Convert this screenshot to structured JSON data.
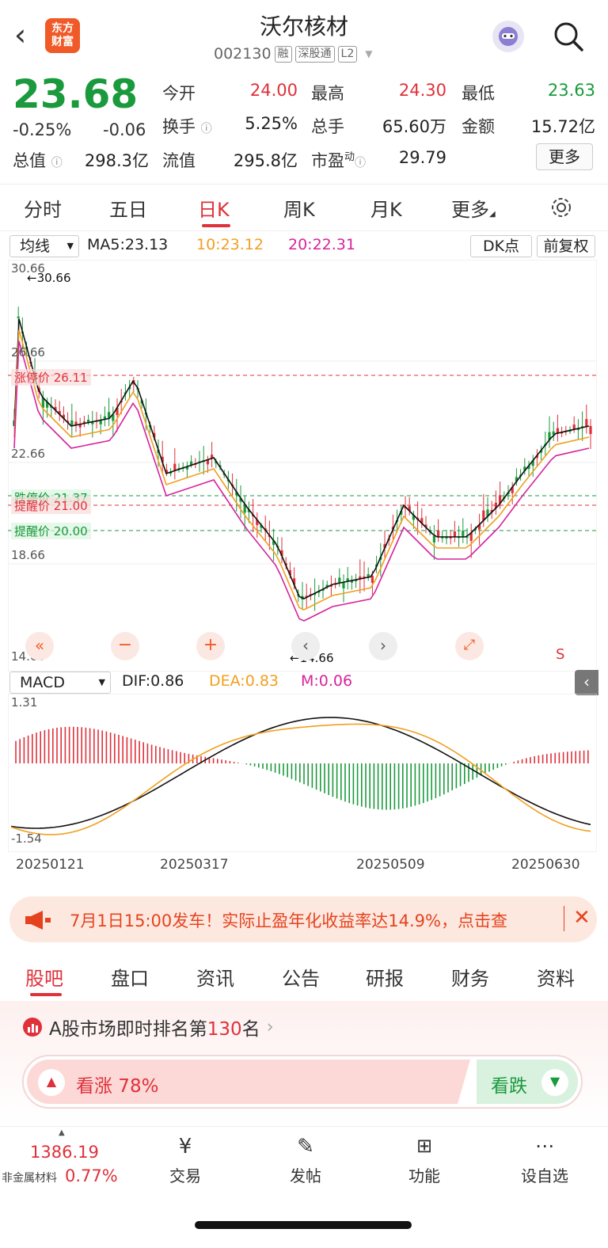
{
  "header": {
    "title": "沃尔核材",
    "code": "002130",
    "tags": [
      "融",
      "深股通",
      "L2"
    ],
    "logo_text": "东方财富"
  },
  "quote": {
    "price": "23.68",
    "change_pct": "-0.25%",
    "change": "-0.06",
    "open_label": "今开",
    "open": "24.00",
    "high_label": "最高",
    "high": "24.30",
    "low_label": "最低",
    "low": "23.63",
    "turnover_label": "换手",
    "turnover": "5.25%",
    "volume_label": "总手",
    "volume": "65.60万",
    "amount_label": "金额",
    "amount": "15.72亿",
    "mcap_label": "总值",
    "mcap": "298.3亿",
    "float_label": "流值",
    "float": "295.8亿",
    "pe_label": "市盈",
    "pe_sup": "动",
    "pe": "29.79",
    "more": "更多"
  },
  "ktabs": [
    "分时",
    "五日",
    "日K",
    "周K",
    "月K",
    "更多"
  ],
  "ma": {
    "select": "均线",
    "ma5": "MA5:23.13",
    "ma10": "10:23.12",
    "ma20": "20:22.31",
    "dk": "DK点",
    "fq": "前复权"
  },
  "kchart": {
    "y_labels": [
      "30.66",
      "26.66",
      "22.66",
      "18.66",
      "14.66"
    ],
    "high_mark": "30.66",
    "low_mark": "14.66",
    "limit_up": "涨停价 26.11",
    "limit_down": "跌停价 21.37",
    "remind1": "提醒价 21.00",
    "remind2": "提醒价 20.00",
    "s_marker": "S"
  },
  "macd": {
    "select": "MACD",
    "dif": "DIF:0.86",
    "dea": "DEA:0.83",
    "m": "M:0.06",
    "top": "1.31",
    "bottom": "-1.54"
  },
  "dates": [
    "20250121",
    "20250317",
    "20250509",
    "20250630"
  ],
  "promo": {
    "text": "7月1日15:00发车！实际止盈年化收益率达14.9%，点击查"
  },
  "btabs": [
    "股吧",
    "盘口",
    "资讯",
    "公告",
    "研报",
    "财务",
    "资料"
  ],
  "rank": {
    "prefix": "A股市场即时排名第",
    "num": "130",
    "suffix": "名"
  },
  "vote": {
    "up": "看涨 78%",
    "down": "看跌",
    "up_pct": 78
  },
  "nav": {
    "index_value": "1386.19",
    "index_name": "非金属材料",
    "index_pct": "0.77%",
    "items": [
      "交易",
      "发帖",
      "功能",
      "设自选"
    ]
  },
  "colors": {
    "red": "#e0303a",
    "green": "#1a9a3c",
    "orange": "#f0a020",
    "magenta": "#d5249c"
  }
}
